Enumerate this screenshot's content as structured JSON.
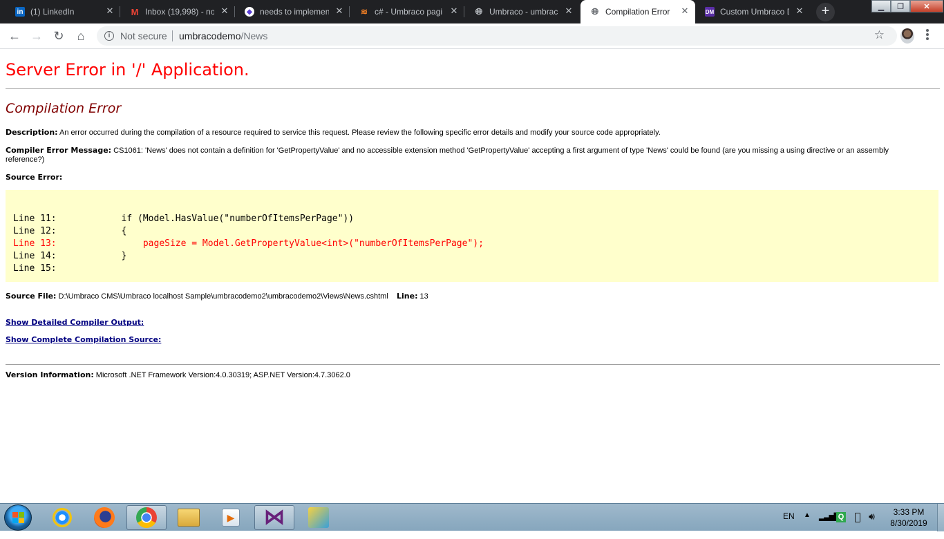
{
  "browser": {
    "tabs": [
      {
        "title": "(1) LinkedIn",
        "icon": "linkedin-icon",
        "active": false
      },
      {
        "title": "Inbox (19,998) - nor",
        "icon": "gmail-icon",
        "active": false
      },
      {
        "title": "needs to implemen",
        "icon": "app-icon",
        "active": false
      },
      {
        "title": "c# - Umbraco pagi",
        "icon": "stackoverflow-icon",
        "active": false
      },
      {
        "title": "Umbraco - umbrac",
        "icon": "globe-icon",
        "active": false
      },
      {
        "title": "Compilation Error",
        "icon": "globe-icon",
        "active": true
      },
      {
        "title": "Custom Umbraco D",
        "icon": "dm-icon",
        "active": false
      }
    ],
    "new_tab": "+",
    "security_label": "Not secure",
    "url_host": "umbracodemo",
    "url_path": "/News"
  },
  "page": {
    "server_error_title": "Server Error in '/' Application.",
    "error_heading": "Compilation Error",
    "description_label": "Description:",
    "description_text": " An error occurred during the compilation of a resource required to service this request. Please review the following specific error details and modify your source code appropriately.",
    "compiler_label": "Compiler Error Message:",
    "compiler_text": " CS1061: 'News' does not contain a definition for 'GetPropertyValue' and no accessible extension method 'GetPropertyValue' accepting a first argument of type 'News' could be found (are you missing a using directive or an assembly reference?)",
    "source_error_label": "Source Error:",
    "code_lines": [
      {
        "text": "Line 11:            if (Model.HasValue(\"numberOfItemsPerPage\"))",
        "error": false
      },
      {
        "text": "Line 12:            {",
        "error": false
      },
      {
        "text": "Line 13:                pageSize = Model.GetPropertyValue<int>(\"numberOfItemsPerPage\");",
        "error": true
      },
      {
        "text": "Line 14:            }",
        "error": false
      },
      {
        "text": "Line 15:",
        "error": false
      }
    ],
    "source_file_label": "Source File:",
    "source_file_value": " D:\\Umbraco CMS\\Umbraco localhost Sample\\umbracodemo2\\umbracodemo2\\Views\\News.cshtml",
    "line_label": "Line:",
    "line_value": " 13",
    "show_compiler_output": "Show Detailed Compiler Output:",
    "show_compilation_source": "Show Complete Compilation Source:",
    "version_label": "Version Information:",
    "version_text": " Microsoft .NET Framework Version:4.0.30319; ASP.NET Version:4.7.3062.0"
  },
  "taskbar": {
    "apps": [
      "internet-explorer-icon",
      "firefox-icon",
      "chrome-icon",
      "file-explorer-icon",
      "media-player-icon",
      "visual-studio-icon",
      "xamarin-icon"
    ],
    "language": "EN",
    "time": "3:33 PM",
    "date": "8/30/2019"
  }
}
